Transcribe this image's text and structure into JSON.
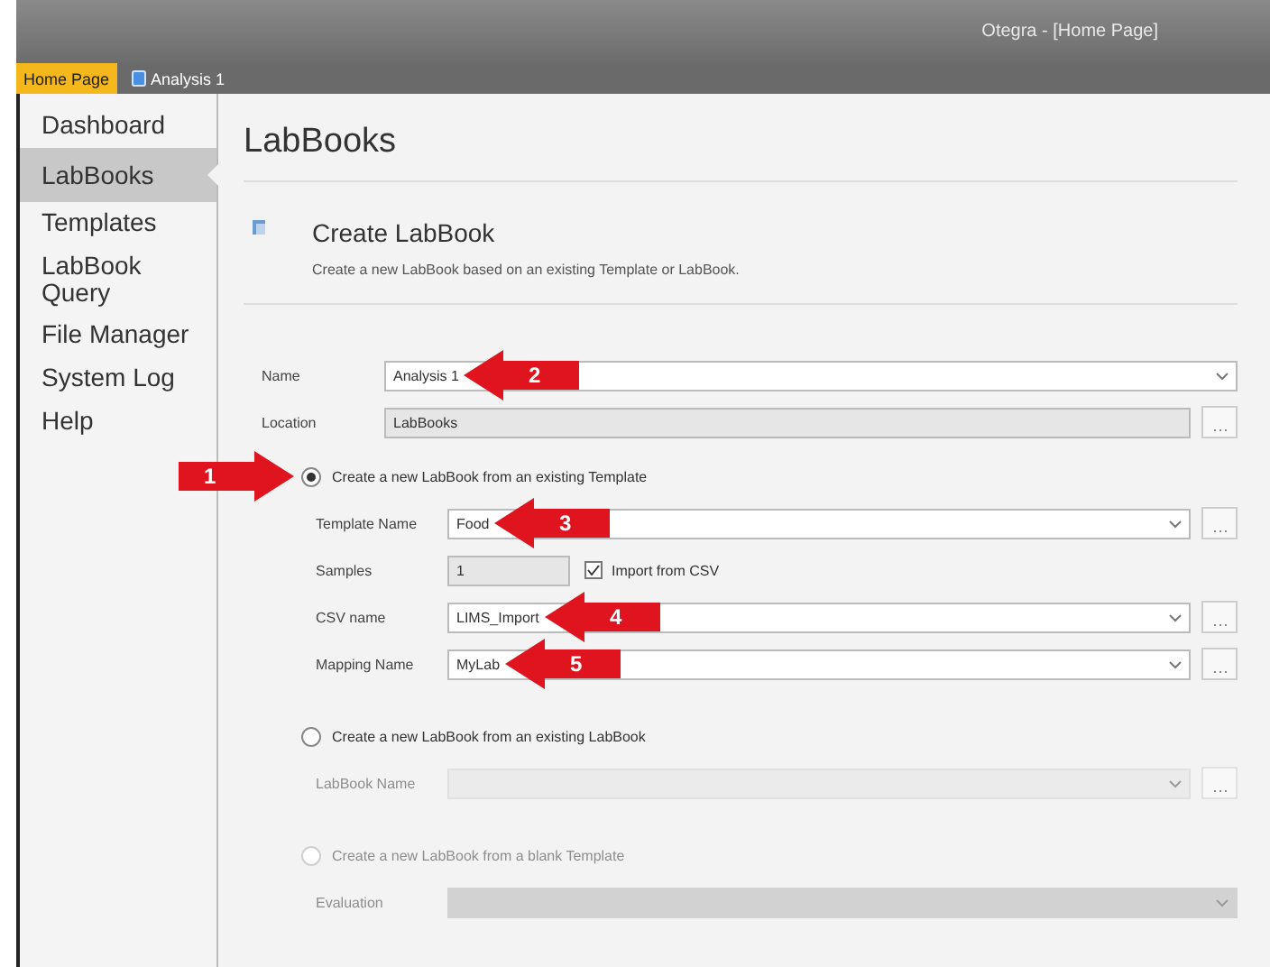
{
  "window": {
    "title": "Otegra - [Home Page]"
  },
  "tabs": [
    {
      "label": "Home Page",
      "selected": true,
      "kind": "plain"
    },
    {
      "label": "Analysis 1",
      "selected": false,
      "kind": "document"
    }
  ],
  "sidebar": {
    "items": [
      {
        "label": "Dashboard",
        "selected": false
      },
      {
        "label": "LabBooks",
        "selected": true
      },
      {
        "label": "Templates",
        "selected": false
      },
      {
        "label": "LabBook Query",
        "selected": false
      },
      {
        "label": "File Manager",
        "selected": false
      },
      {
        "label": "System Log",
        "selected": false
      },
      {
        "label": "Help",
        "selected": false
      }
    ]
  },
  "page": {
    "title": "LabBooks"
  },
  "section": {
    "title": "Create LabBook",
    "subtitle": "Create a new LabBook based on an existing Template or LabBook."
  },
  "fields": [
    {
      "label": "Name",
      "value": "Analysis 1",
      "kind": "combo",
      "callout": "2"
    },
    {
      "label": "Location",
      "value": "LabBooks",
      "kind": "readonly-browse"
    }
  ],
  "options": [
    {
      "label": "Create a new LabBook from an existing Template",
      "selected": true,
      "disabled": false,
      "callout": "1",
      "fields": [
        {
          "label": "Template Name",
          "value": "Food",
          "kind": "combo-browse",
          "callout": "3"
        },
        {
          "label": "Samples",
          "value": "1",
          "kind": "readonly",
          "checkbox": {
            "label": "Import from CSV",
            "checked": true
          }
        },
        {
          "label": "CSV name",
          "value": "LIMS_Import",
          "kind": "combo-browse",
          "callout": "4"
        },
        {
          "label": "Mapping Name",
          "value": "MyLab",
          "kind": "combo-browse",
          "callout": "5"
        }
      ]
    },
    {
      "label": "Create a new LabBook from an existing LabBook",
      "selected": false,
      "disabled": false,
      "fields": [
        {
          "label": "LabBook Name",
          "kind": "combo-browse",
          "disabled": true
        }
      ]
    },
    {
      "label": "Create a new LabBook from a blank Template",
      "selected": false,
      "disabled": true,
      "fields": [
        {
          "label": "Evaluation",
          "kind": "combo",
          "disabled": true
        }
      ]
    }
  ]
}
